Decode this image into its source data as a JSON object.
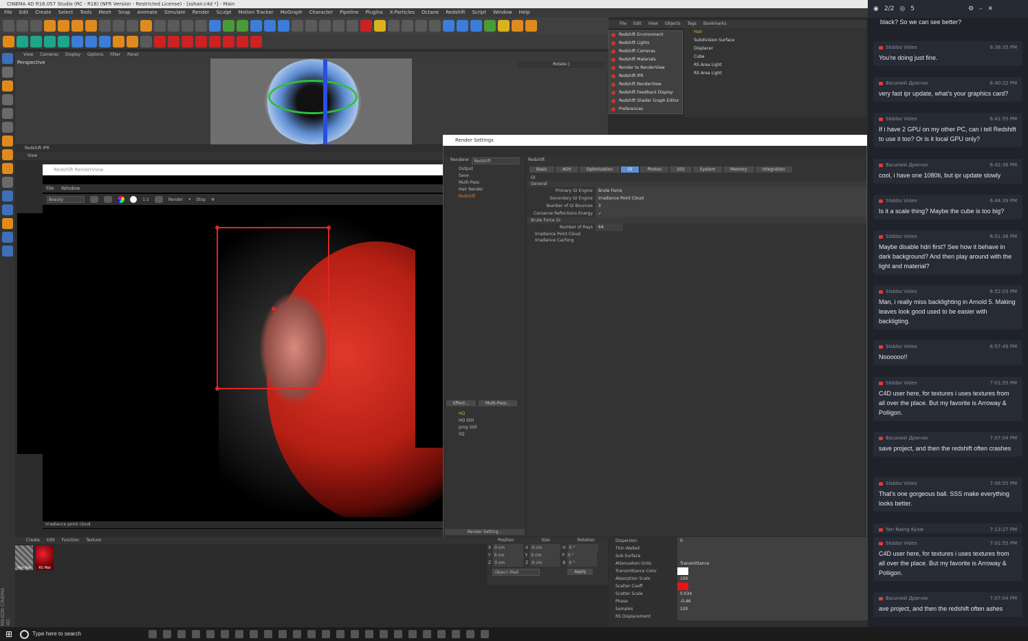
{
  "app": {
    "title": "CINEMA 4D R18.057 Studio (RC - R18) (NFR Version - Restricted License) - [sshair.c4d *] - Main",
    "menu": [
      "File",
      "Edit",
      "Create",
      "Select",
      "Tools",
      "Mesh",
      "Snap",
      "Animate",
      "Simulate",
      "Render",
      "Sculpt",
      "Motion Tracker",
      "MoGraph",
      "Character",
      "Pipeline",
      "Plugins",
      "X-Particles",
      "Octane",
      "Redshift",
      "Script",
      "Window",
      "Help"
    ]
  },
  "viewport": {
    "menu": [
      "View",
      "Cameras",
      "Display",
      "Options",
      "Filter",
      "Panel"
    ],
    "label": "Perspective",
    "rotate": "Rotate ◊"
  },
  "object_manager": {
    "menu": [
      "File",
      "Edit",
      "View",
      "Objects",
      "Tags",
      "Bookmarks"
    ],
    "redshift_menu": [
      "Redshift Environment",
      "Redshift Lights",
      "Redshift Cameras",
      "Redshift Materials",
      "Render to RenderView",
      "Redshift IPR",
      "Redshift RenderView",
      "Redshift Feedback Display",
      "Redshift Shader Graph Editor",
      "Preferences"
    ],
    "objects": [
      "Hair",
      "Subdivision Surface",
      "Displacer",
      "Cube",
      "RS Area Light",
      "RS Area Light"
    ]
  },
  "ipr": {
    "title": "Redshift IPR",
    "view": "View"
  },
  "renderview": {
    "title": "Redshift RenderView",
    "menu": [
      "File",
      "Window"
    ],
    "aov": "Beauty",
    "ratio": "1:1",
    "render_btn": "Render",
    "stop_btn": "Stop",
    "status": "Irradiance point cloud"
  },
  "render_settings": {
    "title": "Render Settings",
    "renderer_label": "Renderer",
    "renderer_value": "Redshift",
    "left_items": [
      "Output",
      "Save",
      "Multi-Pass",
      "Hair Render",
      "Redshift"
    ],
    "effect_btn": "Effect...",
    "multipass_btn": "Multi-Pass...",
    "presets": [
      "HQ",
      "HQ Still",
      "prog Still",
      "SQ"
    ],
    "render_setting_btn": "Render Setting...",
    "section": "Redshift",
    "tabs": [
      "Basic",
      "AOV",
      "Optimization",
      "GI",
      "Photon",
      "SSS",
      "System",
      "Memory",
      "Integration"
    ],
    "active_tab": "GI",
    "subtab": "GI",
    "general": "General",
    "rows": [
      {
        "label": "Primary GI Engine",
        "value": "Brute Force"
      },
      {
        "label": "Secondary GI Engine",
        "value": "Irradiance Point Cloud"
      },
      {
        "label": "Number of GI Bounces",
        "value": "3"
      },
      {
        "label": "Conserve Reflections Energy",
        "value": "✓"
      }
    ],
    "brute_force": "Brute Force GI",
    "rays_label": "Number of Rays",
    "rays_value": "64",
    "irradiance_point_cloud": "Irradiance Point Cloud",
    "irradiance_caching": "Irradiance Caching"
  },
  "materials": {
    "menu": [
      "Create",
      "Edit",
      "Function",
      "Texture"
    ],
    "items": [
      "Hair Mat",
      "RS Mat"
    ]
  },
  "coords": {
    "headers": [
      "Position",
      "Size",
      "Rotation"
    ],
    "rows": [
      [
        "X",
        "0 cm",
        "X",
        "0 cm",
        "H",
        "0 °"
      ],
      [
        "Y",
        "0 cm",
        "Y",
        "0 cm",
        "P",
        "0 °"
      ],
      [
        "Z",
        "0 cm",
        "Z",
        "0 cm",
        "B",
        "0 °"
      ]
    ],
    "mode": "Object (Rel)",
    "apply": "Apply"
  },
  "material_attr": {
    "rows": [
      {
        "label": "Dispersion",
        "value": "0"
      },
      {
        "label": "Thin Walled",
        "value": ""
      },
      {
        "label": "Sub-Surface",
        "value": ""
      },
      {
        "label": "Attenuation Units",
        "value": "Transmittance"
      },
      {
        "label": "Transmittance Color",
        "value": ""
      },
      {
        "label": "Absorption Scale",
        "value": "100"
      },
      {
        "label": "Scatter Coeff",
        "value": ""
      },
      {
        "label": "Scatter Scale",
        "value": "0.034"
      },
      {
        "label": "Phase",
        "value": "-0.46"
      },
      {
        "label": "Samples",
        "value": "120"
      },
      {
        "label": "RS Displacement",
        "value": ""
      }
    ]
  },
  "chat": {
    "counter": "2/2",
    "viewers": "5",
    "first_text": "black? So we can see better?",
    "messages": [
      {
        "user": "Slobbo Video",
        "time": "6:38:35 PM",
        "text": "You're doing just fine."
      },
      {
        "user": "Василий Дрючок",
        "time": "6:40:22 PM",
        "text": "very fast ipr update, what's your graphics card?"
      },
      {
        "user": "Slobbo Video",
        "time": "6:41:55 PM",
        "text": "If i have 2 GPU on my other PC, can i tell Redshift to use it too? Or is it local GPU only?"
      },
      {
        "user": "Василий Дрючок",
        "time": "6:42:36 PM",
        "text": "cool, i have one 1080ti, but ipr update slowly"
      },
      {
        "user": "Slobbo Video",
        "time": "6:44:39 PM",
        "text": "Is it a scale thing? Maybe the cube is too big?"
      },
      {
        "user": "Slobbo Video",
        "time": "6:51:38 PM",
        "text": "Maybe disable hdri first? See how it behave in dark background? And then play around with the light and material?"
      },
      {
        "user": "Slobbo Video",
        "time": "6:52:03 PM",
        "text": "Man, i really miss backlighting in Arnold 5. Making leaves look good used to be easier with backligting."
      },
      {
        "user": "Slobbo Video",
        "time": "6:57:49 PM",
        "text": "Noooooo!!"
      },
      {
        "user": "Slobbo Video",
        "time": "7:01:55 PM",
        "text": "C4D user here, for textures i uses textures from all over the place. But my favorite is Arroway & Poliigon."
      },
      {
        "user": "Василий Дрючок",
        "time": "7:07:04 PM",
        "text": "save project, and then the redshift often crashes"
      },
      {
        "user": "Slobbo Video",
        "time": "7:08:55 PM",
        "text": "That's one gorgeous ball. SSS make everything looks better."
      },
      {
        "user": "Yan Naing Kyaw",
        "time": "7:13:27 PM",
        "text": ""
      },
      {
        "user": "Slobbo Video",
        "time": "7:01:55 PM",
        "text": "C4D user here, for textures i uses textures from all over the place. But my favorite is Arroway & Poliigon."
      },
      {
        "user": "Василий Дрючок",
        "time": "7:07:04 PM",
        "text": "ave project, and then the redshift often ashes"
      }
    ]
  },
  "taskbar": {
    "search_placeholder": "Type here to search"
  },
  "brand": "MAXON CINEMA 4D"
}
